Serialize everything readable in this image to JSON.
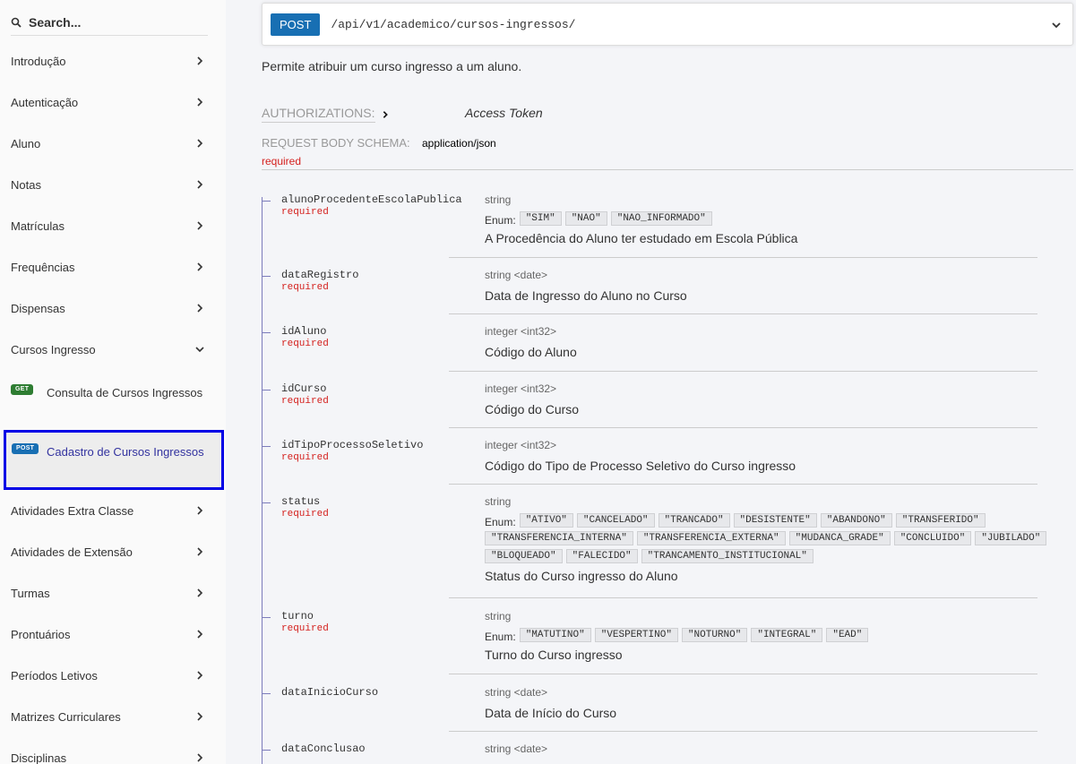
{
  "sidebar": {
    "search_placeholder": "Search...",
    "items": [
      {
        "label": "Introdução"
      },
      {
        "label": "Autenticação"
      },
      {
        "label": "Aluno"
      },
      {
        "label": "Notas"
      },
      {
        "label": "Matrículas"
      },
      {
        "label": "Frequências"
      },
      {
        "label": "Dispensas"
      },
      {
        "label": "Cursos Ingresso"
      }
    ],
    "subitems": [
      {
        "method": "GET",
        "label": "Consulta de Cursos Ingressos",
        "color": "#2e7d32"
      },
      {
        "method": "POST",
        "label": "Cadastro de Cursos Ingressos",
        "color": "#186fb3"
      }
    ],
    "items2": [
      {
        "label": "Atividades Extra Classe"
      },
      {
        "label": "Atividades de Extensão"
      },
      {
        "label": "Turmas"
      },
      {
        "label": "Prontuários"
      },
      {
        "label": "Períodos Letivos"
      },
      {
        "label": "Matrizes Curriculares"
      },
      {
        "label": "Disciplinas"
      }
    ]
  },
  "endpoint": {
    "method": "POST",
    "path": "/api/v1/academico/cursos-ingressos/"
  },
  "description": "Permite atribuir um curso ingresso a um aluno.",
  "authorizations": {
    "label": "AUTHORIZATIONS:",
    "value": "Access Token"
  },
  "request_body": {
    "label": "REQUEST BODY SCHEMA:",
    "type": "application/json",
    "required": "required"
  },
  "fields": [
    {
      "name": "alunoProcedenteEscolaPublica",
      "required": "required",
      "type": "string",
      "enum_label": "Enum:",
      "enum": [
        "\"SIM\"",
        "\"NAO\"",
        "\"NAO_INFORMADO\""
      ],
      "desc": "A Procedência do Aluno ter estudado em Escola Pública"
    },
    {
      "name": "dataRegistro",
      "required": "required",
      "type": "string <date>",
      "desc": "Data de Ingresso do Aluno no Curso"
    },
    {
      "name": "idAluno",
      "required": "required",
      "type": "integer <int32>",
      "desc": "Código do Aluno"
    },
    {
      "name": "idCurso",
      "required": "required",
      "type": "integer <int32>",
      "desc": "Código do Curso"
    },
    {
      "name": "idTipoProcessoSeletivo",
      "required": "required",
      "type": "integer <int32>",
      "desc": "Código do Tipo de Processo Seletivo do Curso ingresso"
    },
    {
      "name": "status",
      "required": "required",
      "type": "string",
      "enum_label": "Enum:",
      "enum": [
        "\"ATIVO\"",
        "\"CANCELADO\"",
        "\"TRANCADO\"",
        "\"DESISTENTE\"",
        "\"ABANDONO\"",
        "\"TRANSFERIDO\"",
        "\"TRANSFERENCIA_INTERNA\"",
        "\"TRANSFERENCIA_EXTERNA\"",
        "\"MUDANCA_GRADE\"",
        "\"CONCLUIDO\"",
        "\"JUBILADO\"",
        "\"BLOQUEADO\"",
        "\"FALECIDO\"",
        "\"TRANCAMENTO_INSTITUCIONAL\""
      ],
      "desc": "Status do Curso ingresso do Aluno"
    },
    {
      "name": "turno",
      "required": "required",
      "type": "string",
      "enum_label": "Enum:",
      "enum": [
        "\"MATUTINO\"",
        "\"VESPERTINO\"",
        "\"NOTURNO\"",
        "\"INTEGRAL\"",
        "\"EAD\""
      ],
      "desc": "Turno do Curso ingresso"
    },
    {
      "name": "dataInicioCurso",
      "required": "",
      "type": "string <date>",
      "desc": "Data de Início do Curso"
    },
    {
      "name": "dataConclusao",
      "required": "",
      "type": "string <date>",
      "desc": ""
    }
  ]
}
